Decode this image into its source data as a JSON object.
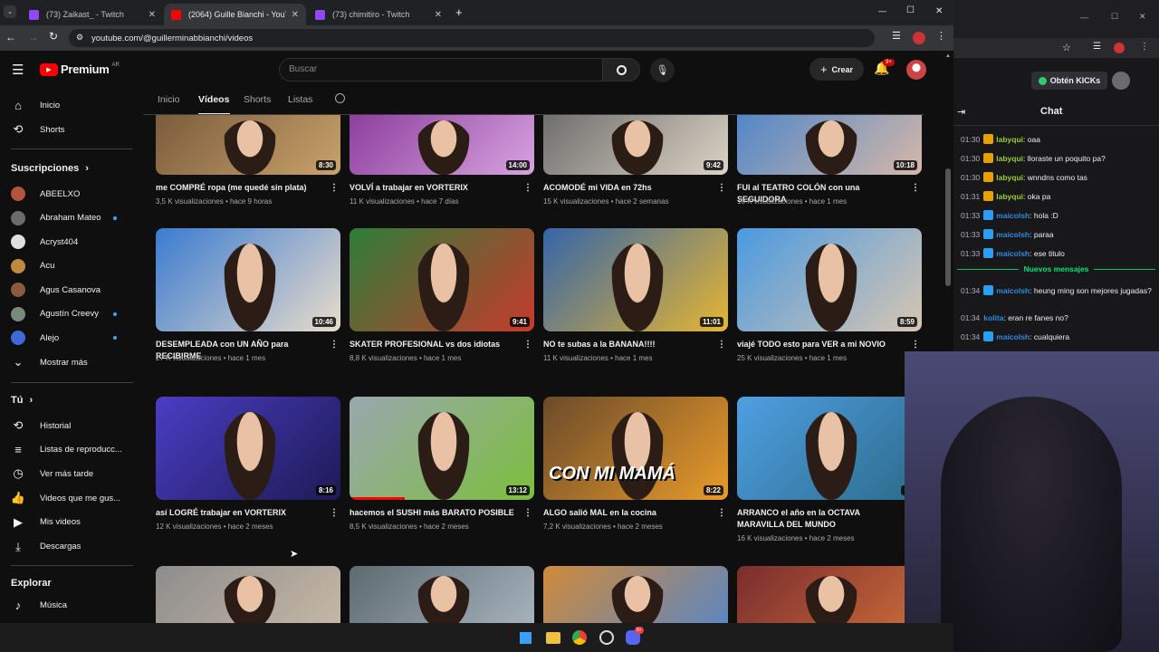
{
  "browser": {
    "tabs": [
      {
        "title": "(73) Zaikast_ - Twitch",
        "color": "#9146ff"
      },
      {
        "title": "(2064) Guille Bianchi - YouTube",
        "color": "#ff0000"
      },
      {
        "title": "(73) chimitiro - Twitch",
        "color": "#9146ff"
      }
    ],
    "new_tab": "+",
    "url": "youtube.com/@guillerminabbianchi/videos",
    "window_controls": [
      "—",
      "☐",
      "✕"
    ]
  },
  "youtube": {
    "logo_text": "Premium",
    "region": "AR",
    "search_placeholder": "Buscar",
    "create_label": "Crear",
    "notifications_count": "9+",
    "tabs": [
      "Inicio",
      "Vídeos",
      "Shorts",
      "Listas"
    ],
    "active_tab": "Vídeos",
    "sidebar": {
      "main": [
        {
          "label": "Inicio",
          "icon": "home-icon"
        },
        {
          "label": "Shorts",
          "icon": "shorts-icon"
        }
      ],
      "subscriptions_header": "Suscripciones",
      "subscriptions": [
        {
          "label": "ABEELXO",
          "new": false,
          "color": "#b5543a"
        },
        {
          "label": "Abraham Mateo",
          "new": true,
          "color": "#6b6b6b"
        },
        {
          "label": "Acryst404",
          "new": false,
          "color": "#e0e0e0"
        },
        {
          "label": "Acu",
          "new": false,
          "color": "#c08a3e"
        },
        {
          "label": "Agus Casanova",
          "new": false,
          "color": "#8a5a3c"
        },
        {
          "label": "Agustín Creevy",
          "new": true,
          "color": "#7a8a7a"
        },
        {
          "label": "Alejo",
          "new": true,
          "color": "#3d6ad6"
        }
      ],
      "show_more": "Mostrar más",
      "you_header": "Tú",
      "you_items": [
        {
          "label": "Historial",
          "icon": "history-icon"
        },
        {
          "label": "Listas de reproducc...",
          "icon": "playlists-icon"
        },
        {
          "label": "Ver más tarde",
          "icon": "watch-later-icon"
        },
        {
          "label": "Videos que me gus...",
          "icon": "like-icon"
        },
        {
          "label": "Mis videos",
          "icon": "my-videos-icon"
        },
        {
          "label": "Descargas",
          "icon": "downloads-icon"
        }
      ],
      "explore_header": "Explorar",
      "explore_items": [
        {
          "label": "Música",
          "icon": "music-icon"
        }
      ]
    },
    "videos": [
      {
        "title": "me COMPRÉ ropa (me quedé sin plata)",
        "views": "3,5 K visualizaciones",
        "age": "hace 9 horas",
        "duration": "8:30",
        "c1": "#7a5a3c",
        "c2": "#c9a36b",
        "progress": 0
      },
      {
        "title": "VOLVÍ a trabajar en VORTERIX",
        "views": "11 K visualizaciones",
        "age": "hace 7 días",
        "duration": "14:00",
        "c1": "#8c3d9c",
        "c2": "#d7a3e0",
        "progress": 0
      },
      {
        "title": "ACOMODÉ mi VIDA en 72hs",
        "views": "15 K visualizaciones",
        "age": "hace 2 semanas",
        "duration": "9:42",
        "c1": "#6d6d6d",
        "c2": "#dcd3c4",
        "progress": 0
      },
      {
        "title": "FUI al TEATRO COLÓN con una SEGUIDORA",
        "views": "10 K visualizaciones",
        "age": "hace 1 mes",
        "duration": "10:18",
        "c1": "#4f86c9",
        "c2": "#d6b8a8",
        "progress": 0
      },
      {
        "title": "DESEMPLEADA con UN AÑO para RECIBIRME",
        "views": "27 K visualizaciones",
        "age": "hace 1 mes",
        "duration": "10:46",
        "c1": "#3b7bd1",
        "c2": "#e8dccb",
        "progress": 0
      },
      {
        "title": "SKATER PROFESIONAL vs dos idiotas",
        "views": "8,8 K visualizaciones",
        "age": "hace 1 mes",
        "duration": "9:41",
        "c1": "#2e7d3a",
        "c2": "#c63b2b",
        "progress": 0
      },
      {
        "title": "NO te subas a la BANANA!!!!",
        "views": "11 K visualizaciones",
        "age": "hace 1 mes",
        "duration": "11:01",
        "c1": "#3565a8",
        "c2": "#e6b533",
        "progress": 0
      },
      {
        "title": "viajé TODO esto para VER a mi NOVIO",
        "views": "25 K visualizaciones",
        "age": "hace 1 mes",
        "duration": "8:59",
        "c1": "#4a9ae0",
        "c2": "#d8c5b3",
        "progress": 0
      },
      {
        "title": "así LOGRÉ trabajar en VORTERIX",
        "views": "12 K visualizaciones",
        "age": "hace 2 meses",
        "duration": "8:16",
        "c1": "#4b3dc4",
        "c2": "#1d1a55",
        "progress": 0
      },
      {
        "title": "hacemos el SUSHI más BARATO POSIBLE",
        "views": "8,5 K visualizaciones",
        "age": "hace 2 meses",
        "duration": "13:12",
        "c1": "#9aa7b0",
        "c2": "#7bbf3d",
        "progress": 0.3
      },
      {
        "title": "ALGO salió MAL en la cocina",
        "views": "7,2 K visualizaciones",
        "age": "hace 2 meses",
        "duration": "8:22",
        "c1": "#6b4a2a",
        "c2": "#e89b2a",
        "progress": 0,
        "overlay": "CON MI MAMÁ"
      },
      {
        "title": "ARRANCO el año en la OCTAVA MARAVILLA DEL MUNDO",
        "views": "16 K visualizaciones",
        "age": "hace 2 meses",
        "duration": "12:",
        "c1": "#4f9fe3",
        "c2": "#2c6b8a",
        "progress": 0
      },
      {
        "title": "",
        "views": "",
        "age": "",
        "duration": "",
        "c1": "#8d8d8d",
        "c2": "#c7b8a5",
        "progress": 0
      },
      {
        "title": "",
        "views": "",
        "age": "",
        "duration": "",
        "c1": "#5d6a72",
        "c2": "#a8b4bd",
        "progress": 0
      },
      {
        "title": "",
        "views": "",
        "age": "",
        "duration": "",
        "c1": "#d08a3a",
        "c2": "#5b86c4",
        "progress": 0
      },
      {
        "title": "",
        "views": "",
        "age": "",
        "duration": "",
        "c1": "#7a2d2d",
        "c2": "#c96a3a",
        "progress": 0
      }
    ]
  },
  "twitch": {
    "get_kicks": "Obtén KICKs",
    "chat_title": "Chat",
    "new_messages": "Nuevos mensajes",
    "messages": [
      {
        "time": "01:30",
        "user": "labyqui",
        "color": "#9acd32",
        "text": "oaa",
        "badge": "#e6a000"
      },
      {
        "time": "01:30",
        "user": "labyqui",
        "color": "#9acd32",
        "text": "lloraste un poquito pa?",
        "badge": "#e6a000"
      },
      {
        "time": "01:30",
        "user": "labyqui",
        "color": "#9acd32",
        "text": "wnndns como tas",
        "badge": "#e6a000"
      },
      {
        "time": "01:31",
        "user": "labyqui",
        "color": "#9acd32",
        "text": "oka pa",
        "badge": "#e6a000"
      },
      {
        "time": "01:33",
        "user": "maicolsh",
        "color": "#2e8bde",
        "text": "hola :D",
        "badge": "#2a9df4"
      },
      {
        "time": "01:33",
        "user": "maicolsh",
        "color": "#2e8bde",
        "text": "paraa",
        "badge": "#2a9df4"
      },
      {
        "time": "01:33",
        "user": "maicolsh",
        "color": "#2e8bde",
        "text": "ese titulo",
        "badge": "#2a9df4"
      },
      {
        "time": "01:34",
        "user": "maicolsh",
        "color": "#2e8bde",
        "text": "heung ming son mejores jugadas?",
        "badge": "#2a9df4"
      },
      {
        "time": "01:34",
        "user": "kolita",
        "color": "#2e8bde",
        "text": "eran re fanes no?",
        "badge": ""
      },
      {
        "time": "01:34",
        "user": "maicolsh",
        "color": "#2e8bde",
        "text": "cualquiera",
        "badge": "#2a9df4"
      }
    ]
  },
  "taskbar": {
    "icons": [
      "windows-start-icon",
      "file-explorer-icon",
      "chrome-icon",
      "obs-icon",
      "discord-icon"
    ],
    "discord_badge": "9+"
  }
}
